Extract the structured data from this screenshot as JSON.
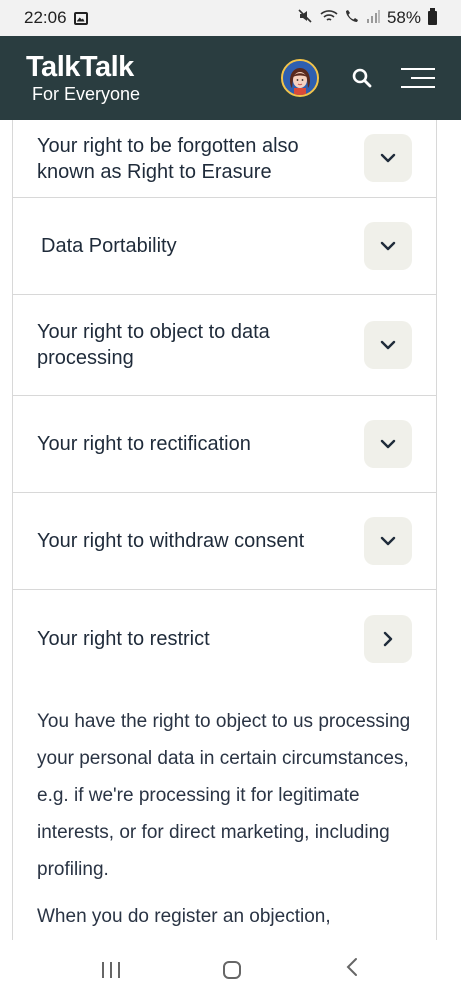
{
  "status_bar": {
    "time": "22:06",
    "battery": "58%"
  },
  "header": {
    "logo_main": "TalkTalk",
    "logo_sub": "For Everyone"
  },
  "accordion": [
    {
      "title": "Your right to be forgotten also known as Right to Erasure",
      "state": "collapsed"
    },
    {
      "title": "Data Portability",
      "state": "collapsed"
    },
    {
      "title": "Your right to object to data processing",
      "state": "collapsed"
    },
    {
      "title": "Your right to rectification",
      "state": "collapsed"
    },
    {
      "title": "Your right to withdraw consent",
      "state": "collapsed"
    },
    {
      "title": "Your right to restrict",
      "state": "expanded"
    }
  ],
  "body": {
    "paragraph1": "You have the right to object to us processing your personal data in certain circumstances, e.g. if we're processing it for legitimate interests, or for direct marketing, including profiling.",
    "paragraph2": "When you do register an objection,"
  },
  "colors": {
    "header_bg": "#2a3d40",
    "button_bg": "#f0f0ea",
    "text": "#1f2b3a"
  }
}
